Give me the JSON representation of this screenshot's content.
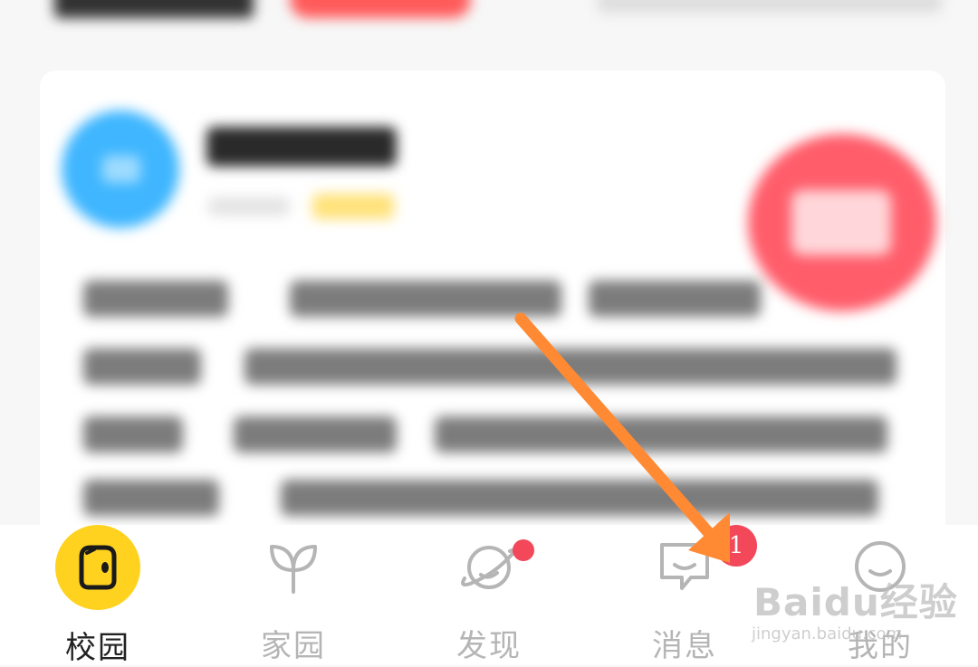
{
  "tabbar": {
    "tabs": [
      {
        "label": "校园",
        "icon": "campus-chick-icon",
        "active": true
      },
      {
        "label": "家园",
        "icon": "sprout-icon",
        "active": false
      },
      {
        "label": "发现",
        "icon": "planet-icon",
        "active": false,
        "dot": true
      },
      {
        "label": "消息",
        "icon": "chat-bubble-icon",
        "active": false,
        "badge": "1"
      },
      {
        "label": "我的",
        "icon": "smiley-face-icon",
        "active": false
      }
    ]
  },
  "annotation": {
    "type": "arrow",
    "color": "#ff8a33",
    "points_to": "消息 badge"
  },
  "watermark": {
    "brand": "Baidu经验",
    "url": "jingyan.baidu.com"
  },
  "colors": {
    "active_yellow": "#ffd21f",
    "badge_red": "#f2485a",
    "inactive_gray": "#b5b5b5",
    "arrow_orange": "#ff8a33"
  }
}
